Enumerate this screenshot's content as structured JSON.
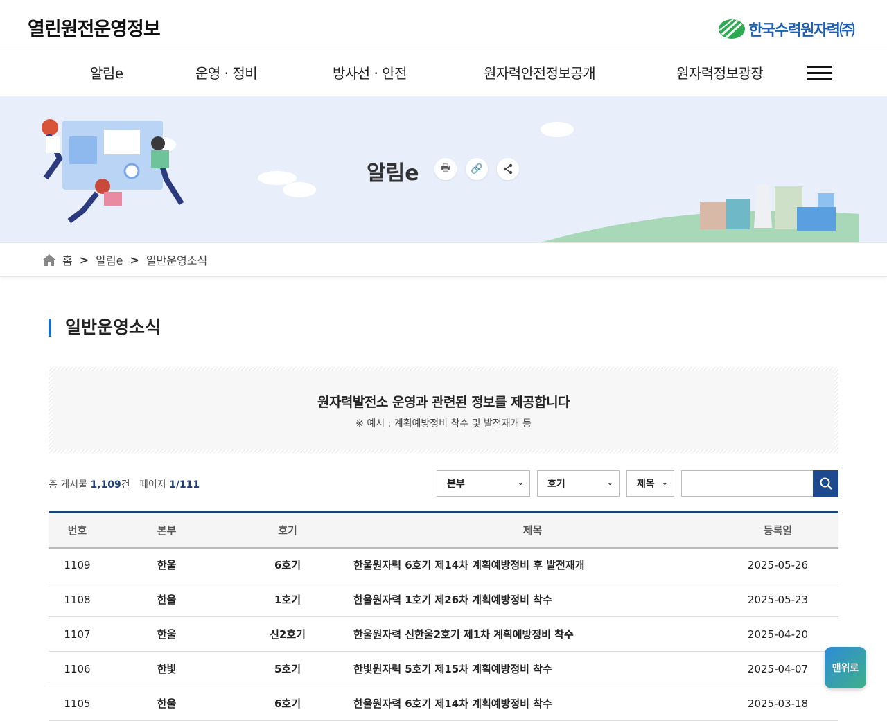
{
  "header": {
    "site_title": "열린원전운영정보",
    "org_name": "한국수력원자력㈜"
  },
  "nav": {
    "items": [
      {
        "label": "알림e"
      },
      {
        "label": "운영 · 정비"
      },
      {
        "label": "방사선 · 안전"
      },
      {
        "label": "원자력안전정보공개"
      },
      {
        "label": "원자력정보광장"
      }
    ]
  },
  "banner": {
    "title": "알림e"
  },
  "breadcrumb": {
    "home": "홈",
    "level1": "알림e",
    "level2": "일반운영소식",
    "separator": ">"
  },
  "section": {
    "title": "일반운영소식"
  },
  "notice": {
    "main": "원자력발전소 운영과 관련된 정보를 제공합니다",
    "sub": "※ 예시 : 계획예방정비 착수 및 발전재개 등"
  },
  "summary": {
    "total_label": "총 게시물",
    "total_value": "1,109",
    "total_unit": "건",
    "page_label": "페이지",
    "page_value": "1/111"
  },
  "filters": {
    "headquarters": "본부",
    "unit": "호기",
    "field": "제목",
    "query": ""
  },
  "table": {
    "columns": [
      "번호",
      "본부",
      "호기",
      "제목",
      "등록일"
    ],
    "rows": [
      [
        "1109",
        "한울",
        "6호기",
        "한울원자력 6호기 제14차 계획예방정비 후 발전재개",
        "2025-05-26"
      ],
      [
        "1108",
        "한울",
        "1호기",
        "한울원자력 1호기 제26차 계획예방정비 착수",
        "2025-05-23"
      ],
      [
        "1107",
        "한울",
        "신2호기",
        "한울원자력 신한울2호기 제1차 계획예방정비 착수",
        "2025-04-20"
      ],
      [
        "1106",
        "한빛",
        "5호기",
        "한빛원자력 5호기 제15차 계획예방정비 착수",
        "2025-04-07"
      ],
      [
        "1105",
        "한울",
        "6호기",
        "한울원자력 6호기 제14차 계획예방정비 착수",
        "2025-03-18"
      ]
    ]
  },
  "scroll_top": {
    "label": "맨위로"
  },
  "colors": {
    "accent": "#1d3f7a",
    "search_button": "#1d4a8f",
    "banner_bg": "#e8effb"
  }
}
